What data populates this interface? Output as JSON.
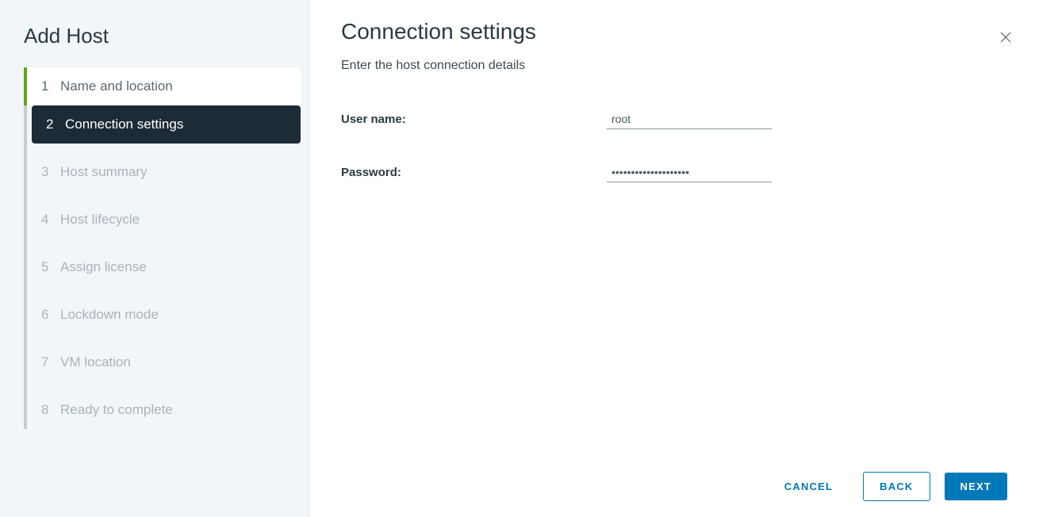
{
  "wizard": {
    "title": "Add Host",
    "steps": [
      {
        "number": "1",
        "label": "Name and location"
      },
      {
        "number": "2",
        "label": "Connection settings"
      },
      {
        "number": "3",
        "label": "Host summary"
      },
      {
        "number": "4",
        "label": "Host lifecycle"
      },
      {
        "number": "5",
        "label": "Assign license"
      },
      {
        "number": "6",
        "label": "Lockdown mode"
      },
      {
        "number": "7",
        "label": "VM location"
      },
      {
        "number": "8",
        "label": "Ready to complete"
      }
    ]
  },
  "content": {
    "title": "Connection settings",
    "subtitle": "Enter the host connection details"
  },
  "form": {
    "username_label": "User name:",
    "username_value": "root",
    "password_label": "Password:",
    "password_value": "••••••••••••••••••••"
  },
  "footer": {
    "cancel_label": "CANCEL",
    "back_label": "BACK",
    "next_label": "NEXT"
  }
}
